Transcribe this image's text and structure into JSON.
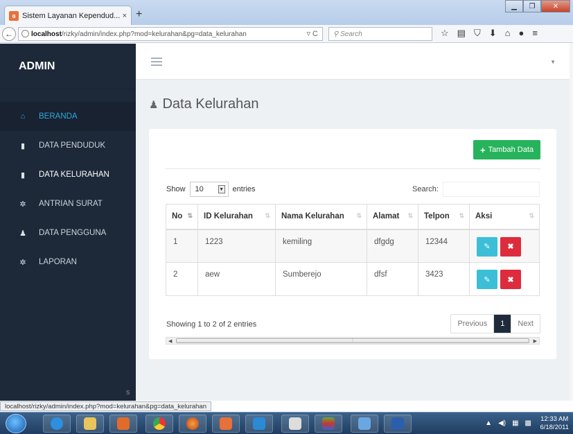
{
  "browser": {
    "tab_title": "Sistem Layanan Kependud...",
    "tab_close": "×",
    "new_tab": "+",
    "url_host": "localhost",
    "url_path": "/rizky/admin/index.php?mod=kelurahan&pg=data_kelurahan",
    "search_placeholder": "Search",
    "status_url": "localhost/rizky/admin/index.php?mod=kelurahan&pg=data_kelurahan"
  },
  "sidebar": {
    "brand": "ADMIN",
    "items": [
      {
        "label": "BERANDA",
        "icon": "home-icon"
      },
      {
        "label": "DATA PENDUDUK",
        "icon": "file-icon"
      },
      {
        "label": "DATA KELURAHAN",
        "icon": "file-icon"
      },
      {
        "label": "ANTRIAN SURAT",
        "icon": "wrench-icon"
      },
      {
        "label": "DATA PENGGUNA",
        "icon": "user-icon"
      },
      {
        "label": "LAPORAN",
        "icon": "wrench-icon"
      }
    ]
  },
  "page": {
    "title": "Data Kelurahan",
    "add_button": "Tambah Data",
    "show_label": "Show",
    "entries_value": "10",
    "entries_label": "entries",
    "search_label": "Search:",
    "info": "Showing 1 to 2 of 2 entries",
    "prev": "Previous",
    "current_page": "1",
    "next": "Next",
    "footer_text": "s"
  },
  "table": {
    "headers": [
      "No",
      "ID Kelurahan",
      "Nama Kelurahan",
      "Alamat",
      "Telpon",
      "Aksi"
    ],
    "rows": [
      {
        "no": "1",
        "id": "1223",
        "nama": "kemiling",
        "alamat": "dfgdg",
        "telpon": "12344"
      },
      {
        "no": "2",
        "id": "aew",
        "nama": "Sumberejo",
        "alamat": "dfsf",
        "telpon": "3423"
      }
    ]
  },
  "taskbar": {
    "time": "12:33 AM",
    "date": "6/18/2011"
  },
  "colors": {
    "sidebar_bg": "#1d2939",
    "active_link": "#2ea9e0",
    "add_button": "#27b35b",
    "edit_button": "#3cbfd6",
    "delete_button": "#dd2c3d"
  }
}
